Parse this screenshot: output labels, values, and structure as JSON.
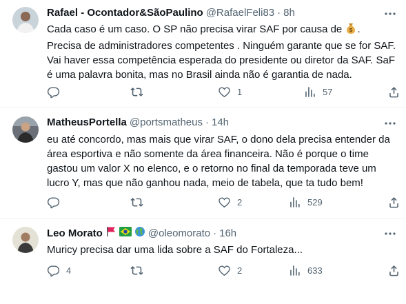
{
  "colors": {
    "text": "#0f1419",
    "muted": "#536471",
    "divider": "#eff3f4"
  },
  "tweets": [
    {
      "name": "Rafael - Ocontador&SãoPaulino",
      "handle": "@RafaelFeli83",
      "dot": "·",
      "time": "8h",
      "text_part1": "Cada caso é um caso. O SP não precisa virar SAF por causa de ",
      "text_emoji_icon": "money-bag-icon",
      "text_part2": ". Precisa de administradores competentes . Ninguém garante que se for  SAF. Vai haver essa competência esperada do presidente ou diretor da SAF. SaF é uma palavra bonita, mas no Brasil ainda não é garantia de nada.",
      "replies": "",
      "retweets": "",
      "likes": "1",
      "views": "57"
    },
    {
      "name": "MatheusPortella",
      "handle": "@portsmatheus",
      "dot": "·",
      "time": "14h",
      "text": "eu até concordo, mas mais que virar SAF, o dono dela precisa entender da área esportiva e não somente da área financeira. Não é porque o time gastou um valor X no elenco, e o retorno no final da temporada teve um lucro Y, mas que não ganhou nada, meio de tabela, que ta tudo bem!",
      "replies": "",
      "retweets": "",
      "likes": "2",
      "views": "529"
    },
    {
      "name": "Leo Morato",
      "name_badges": [
        "red-flag-icon",
        "brazil-flag-icon",
        "globe-icon"
      ],
      "handle": "@oleomorato",
      "dot": "·",
      "time": "16h",
      "text": "Muricy precisa dar uma lida sobre a SAF do Fortaleza...",
      "replies": "4",
      "retweets": "",
      "likes": "2",
      "views": "633"
    }
  ]
}
